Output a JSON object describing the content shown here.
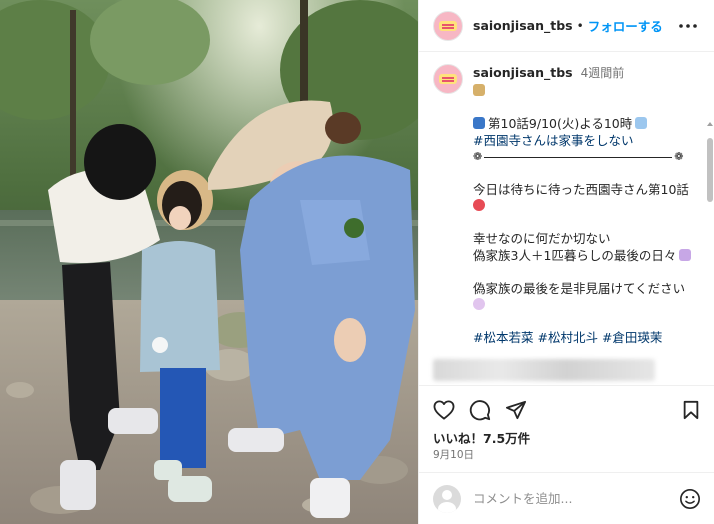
{
  "header": {
    "username": "saionjisan_tbs",
    "dot": "•",
    "follow_label": "フォローする"
  },
  "caption": {
    "username": "saionjisan_tbs",
    "time_ago": "4週間前",
    "lines": {
      "l1": "第10話9/10(火)よる10時",
      "l2": "#西園寺さんは家事をしない",
      "l3": "今日は待ちに待った西園寺さん第10話",
      "l4": "幸せなのに何だか切ない",
      "l5": "偽家族3人＋1匹暮らしの最後の日々",
      "l6": "偽家族の最後を是非見届けてください",
      "hashtags": [
        "#松本若菜",
        "#松村北斗",
        "#倉田瑛茉"
      ]
    },
    "divider_knob": "❁"
  },
  "likes": "いいね！7.5万件",
  "date": "9月10日",
  "comment": {
    "placeholder": "コメントを追加..."
  },
  "icons": {
    "more": "more-horizontal-icon",
    "like": "heart-icon",
    "comment": "comment-bubble-icon",
    "share": "paper-plane-icon",
    "save": "bookmark-icon",
    "emoji": "smiley-icon"
  },
  "colors": {
    "follow_blue": "#0095f6",
    "hashtag_blue": "#00376b",
    "meta_grey": "#737373"
  }
}
